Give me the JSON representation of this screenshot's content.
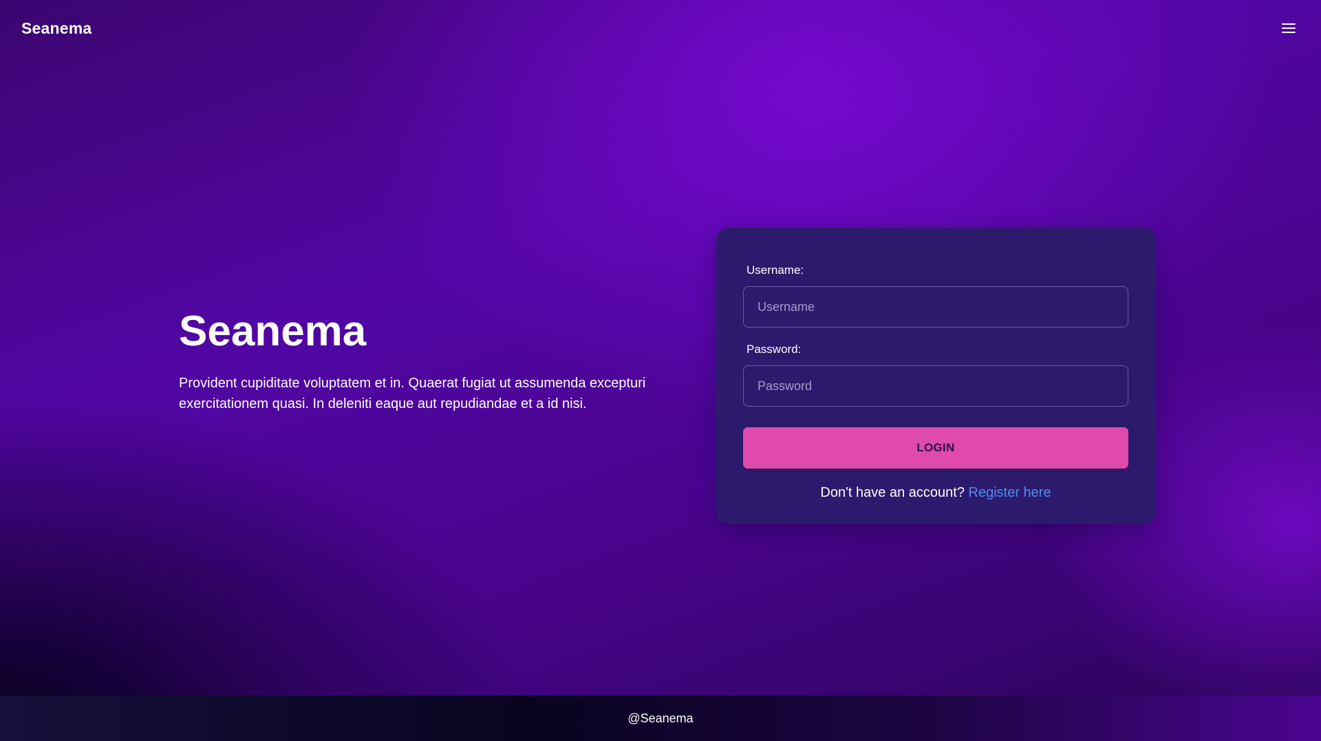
{
  "header": {
    "brand": "Seanema",
    "menu_icon": "hamburger-menu-icon"
  },
  "hero": {
    "title": "Seanema",
    "description_line1": "Provident cupiditate voluptatem et in. Quaerat fugiat ut assumenda excepturi",
    "description_line2": "exercitationem quasi. In deleniti eaque aut repudiandae et a id nisi."
  },
  "login_form": {
    "username_label": "Username:",
    "username_placeholder": "Username",
    "username_value": "",
    "password_label": "Password:",
    "password_placeholder": "Password",
    "password_value": "",
    "login_button": "LOGIN",
    "register_prompt": "Don't have an account?",
    "register_link": "Register here"
  },
  "footer": {
    "text": "@Seanema"
  },
  "colors": {
    "card_bg": "#2c1b6c",
    "button_bg": "#e04aad",
    "link": "#4f8cf0",
    "background_accent": "#7608d0"
  }
}
